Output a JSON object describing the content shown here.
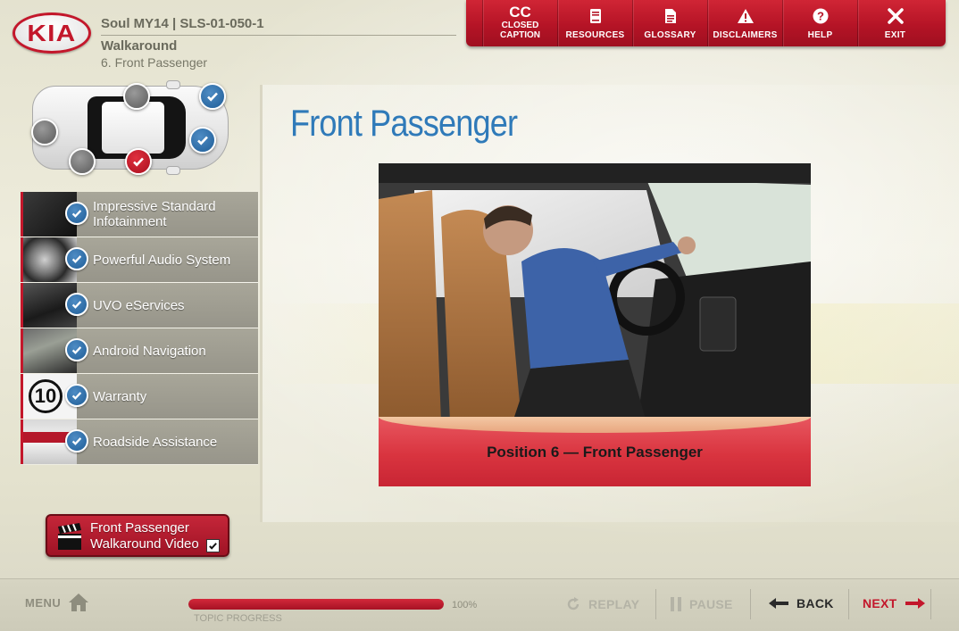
{
  "brand": {
    "logo_text": "KIA",
    "accent": "#c3172b"
  },
  "header": {
    "course": "Soul MY14 | SLS-01-050-1",
    "section": "Walkaround",
    "page": "6. Front Passenger"
  },
  "topnav": {
    "items": [
      {
        "top": "CC",
        "label": "CLOSED\nCAPTION",
        "icon": "closed-caption-icon"
      },
      {
        "label": "RESOURCES",
        "icon": "book-icon"
      },
      {
        "label": "GLOSSARY",
        "icon": "document-icon"
      },
      {
        "label": "DISCLAIMERS",
        "icon": "warning-icon"
      },
      {
        "label": "HELP",
        "icon": "help-icon"
      },
      {
        "label": "EXIT",
        "icon": "close-icon"
      }
    ]
  },
  "car_positions": [
    {
      "status": "not-visited"
    },
    {
      "status": "completed"
    },
    {
      "status": "not-visited"
    },
    {
      "status": "completed"
    },
    {
      "status": "not-visited"
    },
    {
      "status": "current"
    }
  ],
  "topics": [
    {
      "label": "Impressive Standard Infotainment",
      "completed": true
    },
    {
      "label": "Powerful Audio System",
      "completed": true
    },
    {
      "label": "UVO eServices",
      "completed": true
    },
    {
      "label": "Android Navigation",
      "completed": true
    },
    {
      "label": "Warranty",
      "completed": true,
      "thumb_text": "10"
    },
    {
      "label": "Roadside Assistance",
      "completed": true
    }
  ],
  "content": {
    "title": "Front Passenger",
    "video_caption": "Position 6 — Front Passenger",
    "title_color": "#2f7ab9"
  },
  "video_button": {
    "line1": "Front Passenger",
    "line2": "Walkaround Video",
    "watched": true
  },
  "footer": {
    "menu_label": "MENU",
    "progress_value": "100%",
    "progress_fraction": 1.0,
    "progress_label": "TOPIC PROGRESS",
    "replay_label": "REPLAY",
    "pause_label": "PAUSE",
    "back_label": "BACK",
    "next_label": "NEXT"
  }
}
